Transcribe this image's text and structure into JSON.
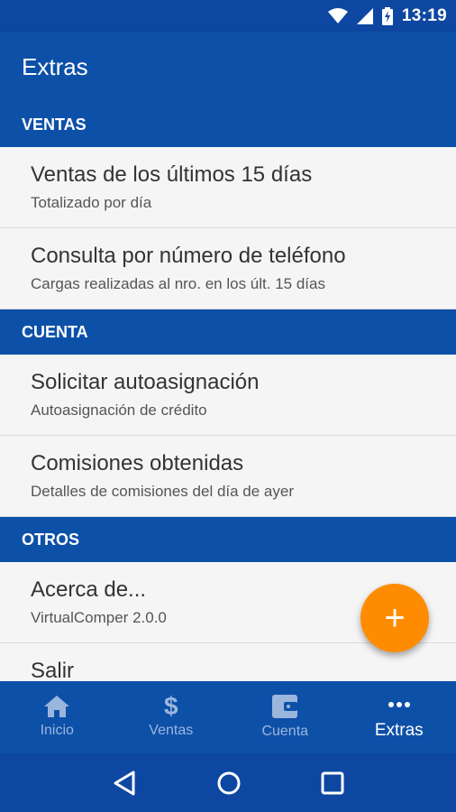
{
  "status_bar": {
    "time": "13:19"
  },
  "app_bar": {
    "title": "Extras"
  },
  "sections": [
    {
      "header": "VENTAS",
      "items": [
        {
          "title": "Ventas de los últimos 15 días",
          "subtitle": "Totalizado por día"
        },
        {
          "title": "Consulta por número de teléfono",
          "subtitle": "Cargas realizadas al nro. en los últ. 15 días"
        }
      ]
    },
    {
      "header": "CUENTA",
      "items": [
        {
          "title": "Solicitar autoasignación",
          "subtitle": "Autoasignación de crédito"
        },
        {
          "title": "Comisiones obtenidas",
          "subtitle": "Detalles de comisiones del día de ayer"
        }
      ]
    },
    {
      "header": "OTROS",
      "items": [
        {
          "title": "Acerca de...",
          "subtitle": "VirtualComper 2.0.0"
        },
        {
          "title": "Salir",
          "subtitle": ""
        }
      ]
    }
  ],
  "fab": {
    "icon": "plus-icon",
    "label": "+"
  },
  "bottom_nav": [
    {
      "label": "Inicio",
      "icon": "home-icon",
      "active": false
    },
    {
      "label": "Ventas",
      "icon": "dollar-icon",
      "active": false
    },
    {
      "label": "Cuenta",
      "icon": "wallet-icon",
      "active": false
    },
    {
      "label": "Extras",
      "icon": "more-icon",
      "active": true
    }
  ],
  "colors": {
    "primary": "#0d50a8",
    "accent": "#ff8c00",
    "inactive_nav": "#9bb6dd"
  }
}
